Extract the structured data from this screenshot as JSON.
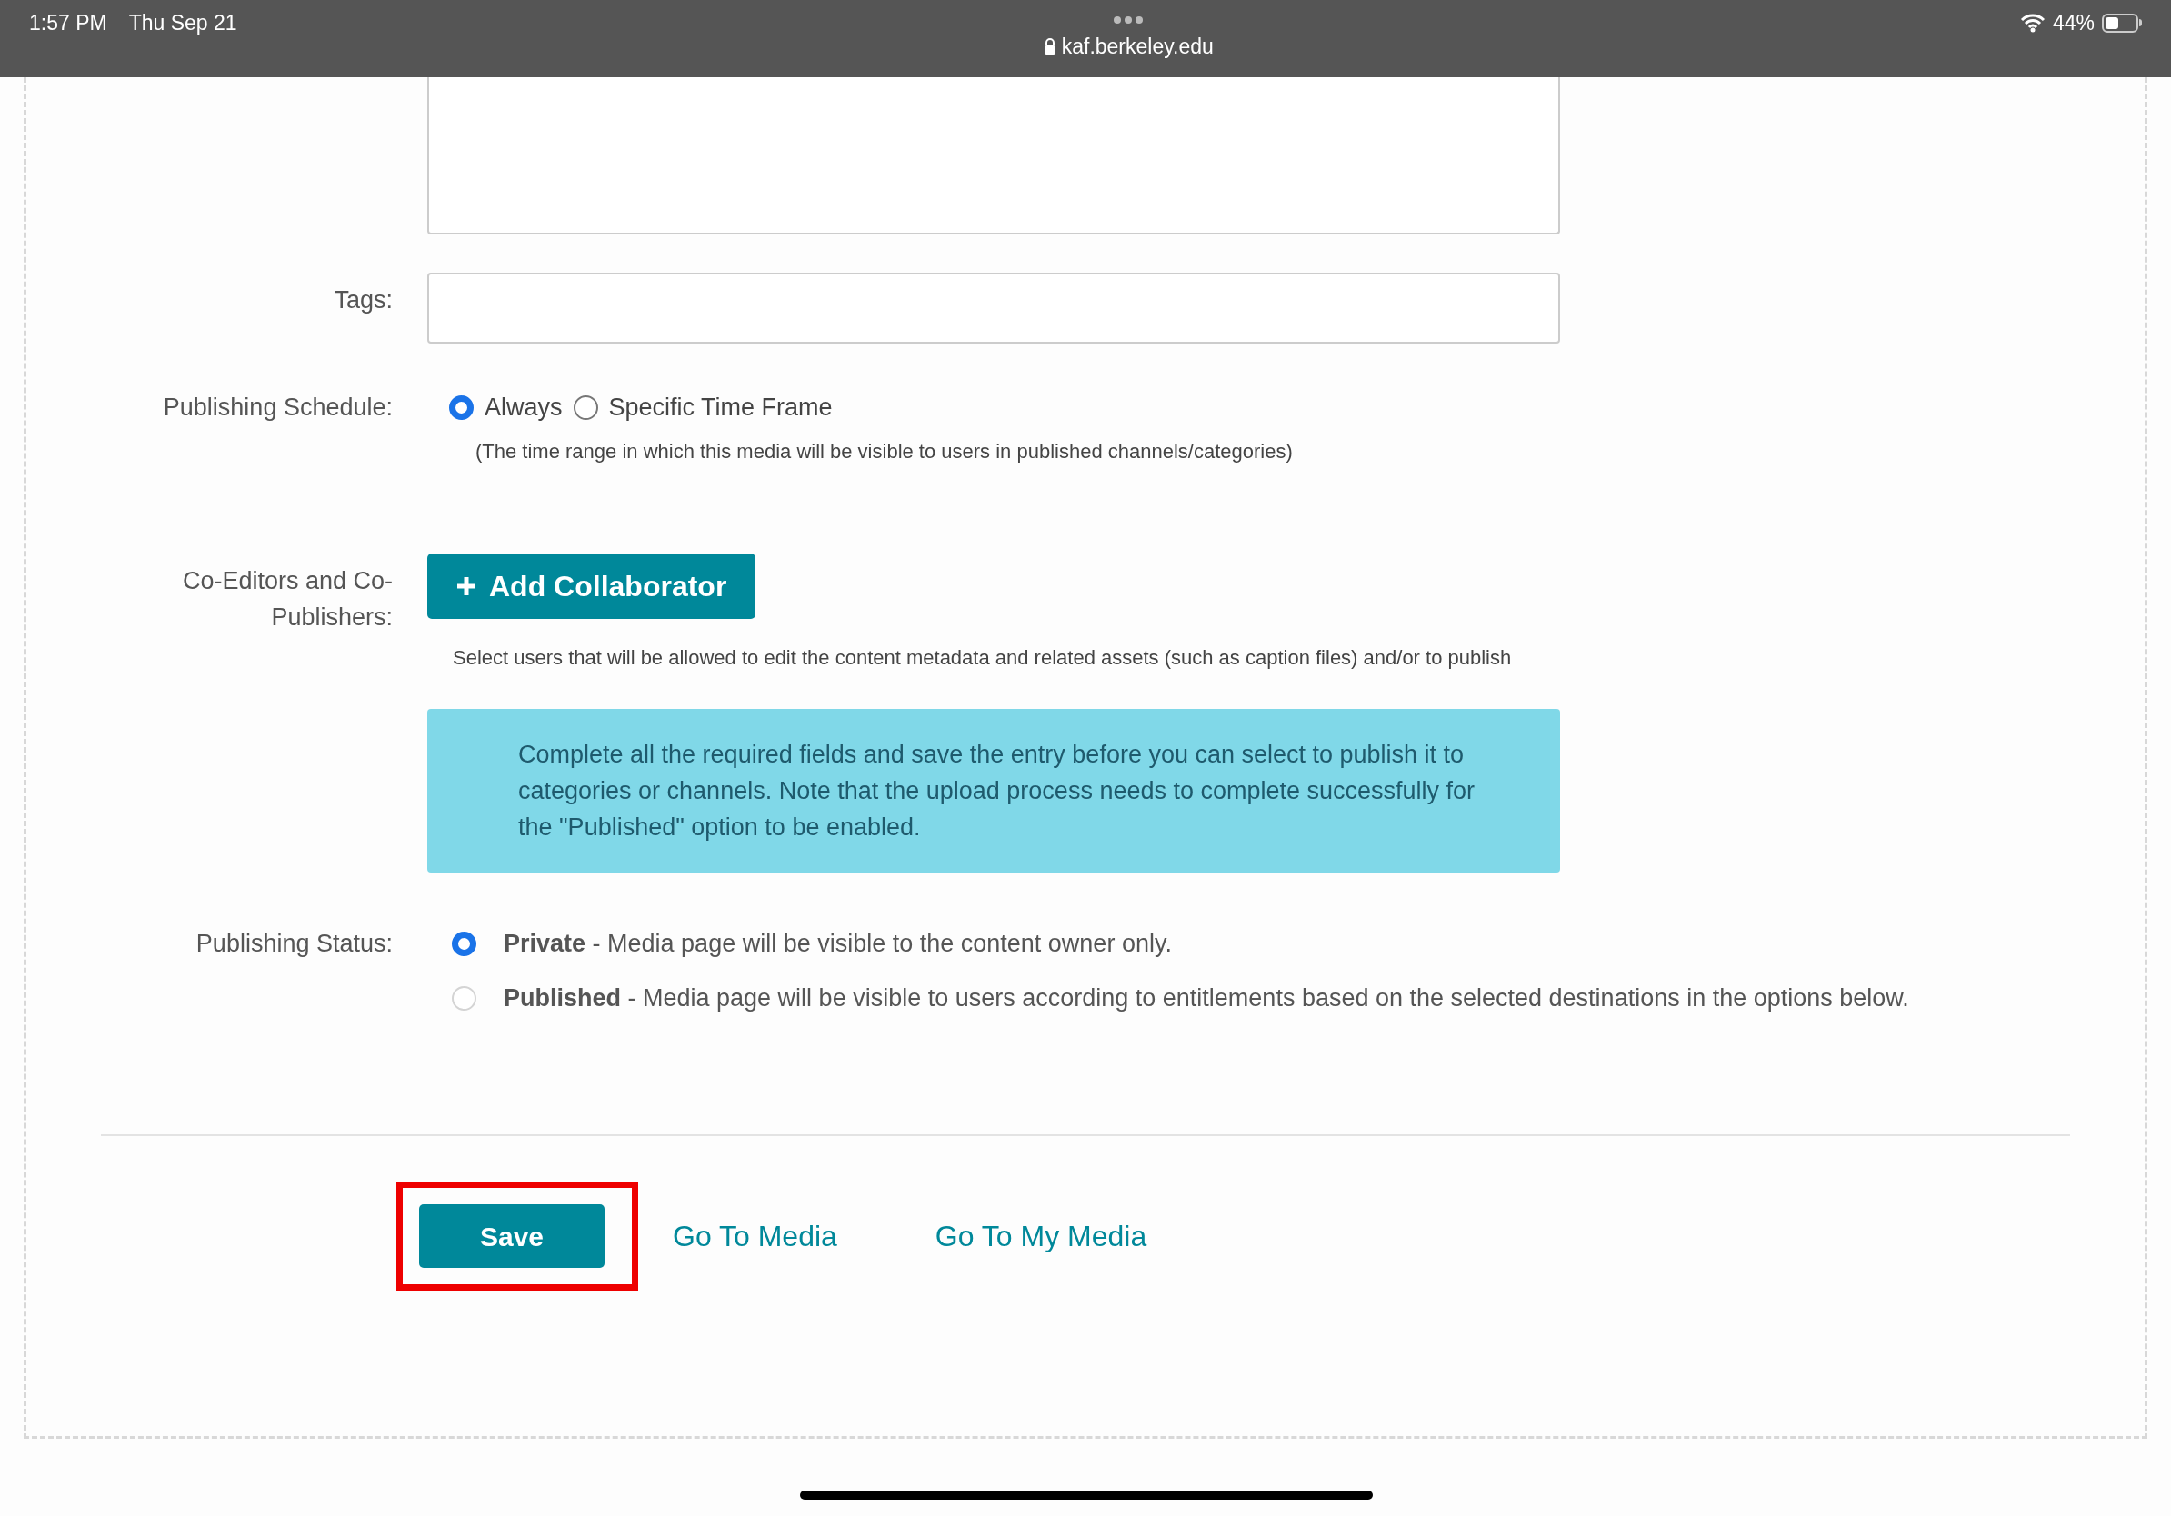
{
  "status_bar": {
    "time": "1:57 PM",
    "date": "Thu Sep 21",
    "url": "kaf.berkeley.edu",
    "battery": "44%"
  },
  "tags": {
    "label": "Tags:"
  },
  "publishing_schedule": {
    "label": "Publishing Schedule:",
    "options": [
      {
        "label": "Always",
        "selected": true
      },
      {
        "label": "Specific Time Frame",
        "selected": false
      }
    ],
    "hint": "(The time range in which this media will be visible to users in published channels/categories)"
  },
  "collaborators": {
    "label": "Co-Editors and Co-Publishers:",
    "button": "Add Collaborator",
    "hint": "Select users that will be allowed to edit the content metadata and related assets (such as caption files) and/or to publish"
  },
  "notice": "Complete all the required fields and save the entry before you can select to publish it to categories or channels. Note that the upload process needs to complete successfully for the \"Published\" option to be enabled.",
  "publishing_status": {
    "label": "Publishing Status:",
    "options": [
      {
        "title": "Private",
        "description": " - Media page will be visible to the content owner only.",
        "selected": true
      },
      {
        "title": "Published",
        "description": " - Media page will be visible to users according to entitlements based on the selected destinations in the options below.",
        "selected": false
      }
    ]
  },
  "actions": {
    "save": "Save",
    "save_highlighted": true,
    "links": [
      "Go To Media",
      "Go To My Media"
    ]
  }
}
